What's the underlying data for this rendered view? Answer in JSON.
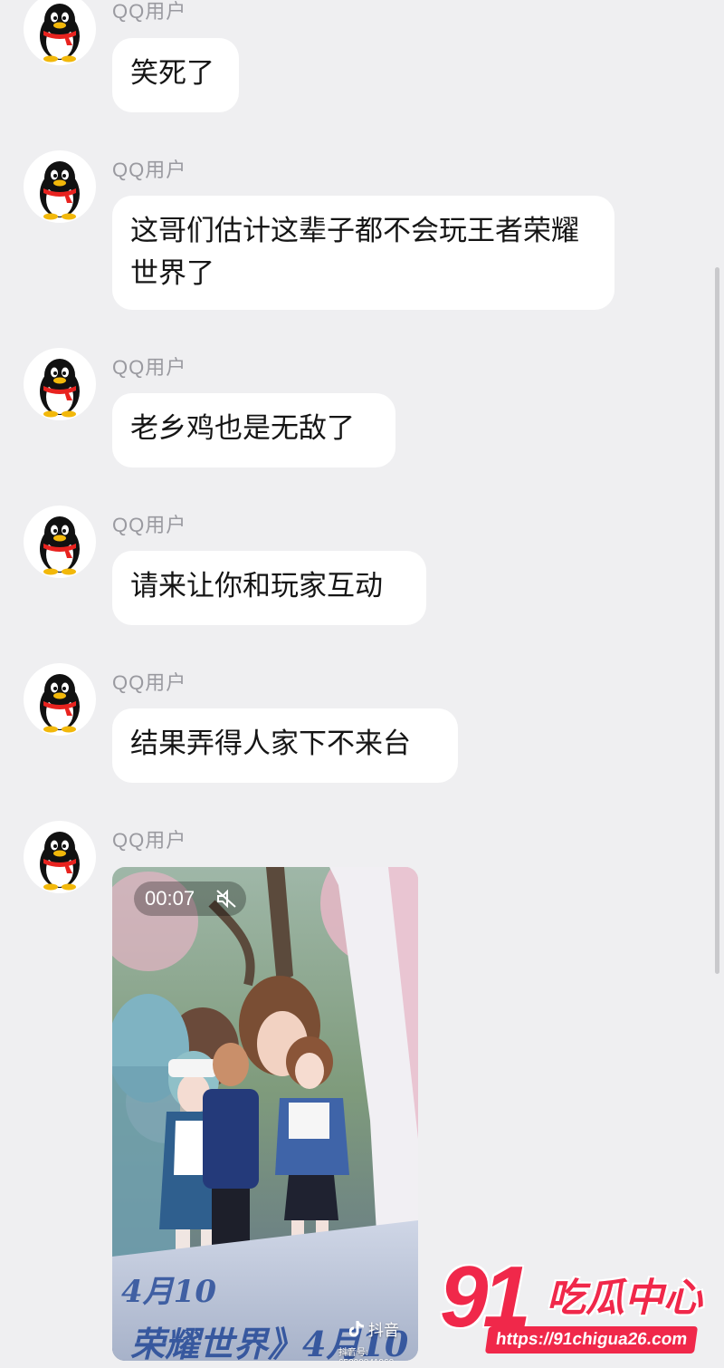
{
  "messages": [
    {
      "sender": "QQ用户",
      "text": "笑死了"
    },
    {
      "sender": "QQ用户",
      "text": "这哥们估计这辈子都不会玩王者荣耀世界了"
    },
    {
      "sender": "QQ用户",
      "text": "老乡鸡也是无敌了"
    },
    {
      "sender": "QQ用户",
      "text": "请来让你和玩家互动"
    },
    {
      "sender": "QQ用户",
      "text": "结果弄得人家下不来台"
    },
    {
      "sender": "QQ用户",
      "video": {
        "duration": "00:07",
        "mute_icon": "speaker-muted-icon",
        "watermark_app": "抖音",
        "watermark_id": "抖音号: 65290841960",
        "banner_text": "荣耀世界》4月10",
        "banner_text_2": "4月10"
      }
    }
  ],
  "watermark": {
    "number": "91",
    "text": "吃瓜中心",
    "url": "https://91chigua26.com"
  },
  "colors": {
    "background": "#efeff1",
    "bubble": "#ffffff",
    "sender": "#9a9aa0",
    "watermark": "#f0284a"
  }
}
